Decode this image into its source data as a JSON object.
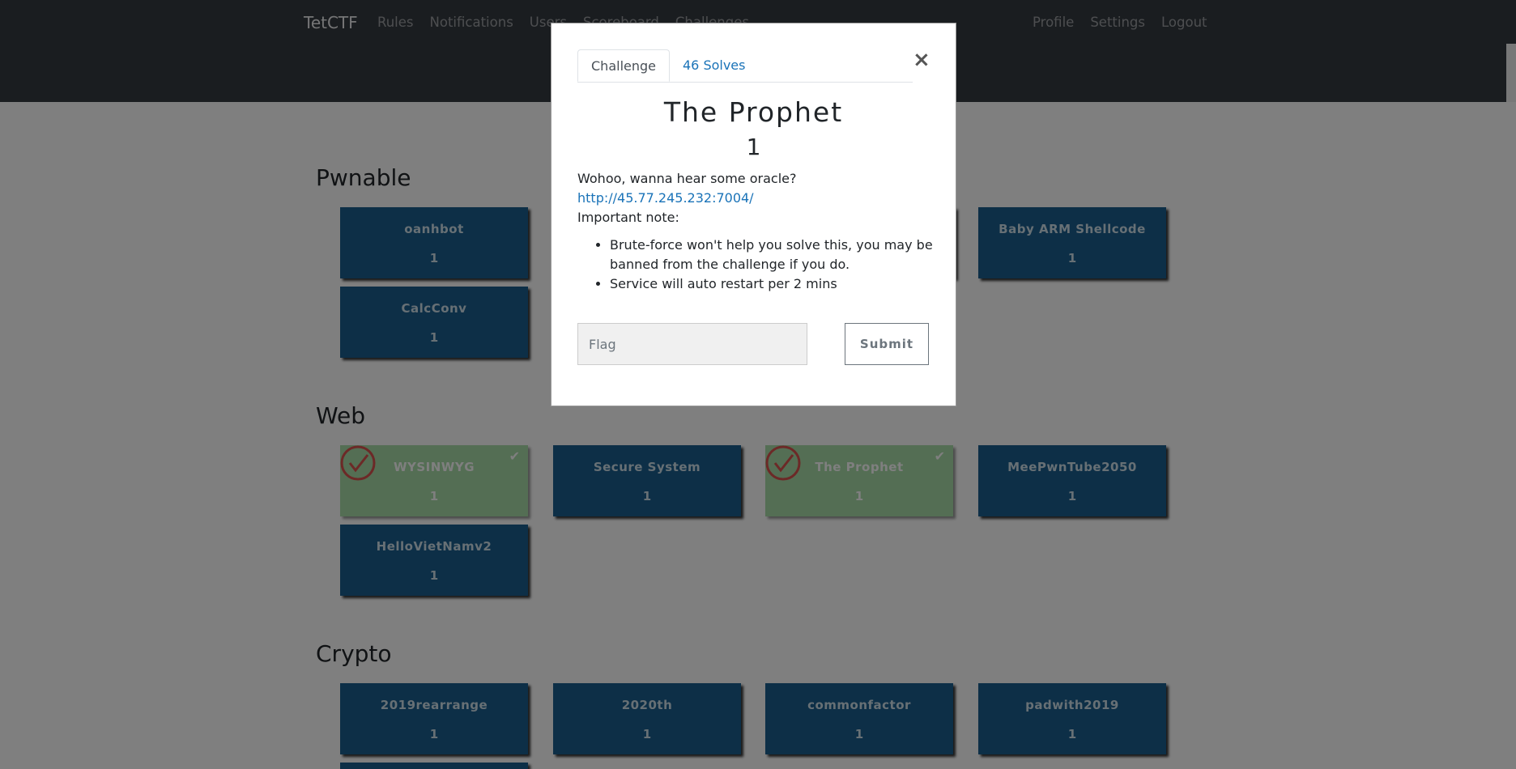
{
  "navbar": {
    "brand": "TetCTF",
    "left_links": [
      "Rules",
      "Notifications",
      "Users",
      "Scoreboard",
      "Challenges"
    ],
    "right_links": [
      "Profile",
      "Settings",
      "Logout"
    ]
  },
  "categories": [
    {
      "name": "Pwnable",
      "challenges": [
        {
          "name": "oanhbot",
          "value": "1"
        },
        {
          "name": "Baby ARM Shellcode",
          "value": "1"
        },
        {
          "name": "CalcConv",
          "value": "1"
        }
      ]
    },
    {
      "name": "Web",
      "challenges": [
        {
          "name": "WYSINWYG",
          "value": "1",
          "solved": true
        },
        {
          "name": "Secure System",
          "value": "1"
        },
        {
          "name": "The Prophet",
          "value": "1",
          "solved": true
        },
        {
          "name": "MeePwnTube2050",
          "value": "1"
        },
        {
          "name": "HelloVietNamv2",
          "value": "1"
        }
      ]
    },
    {
      "name": "Crypto",
      "challenges": [
        {
          "name": "2019rearrange",
          "value": "1"
        },
        {
          "name": "2020th",
          "value": "1"
        },
        {
          "name": "commonfactor",
          "value": "1"
        },
        {
          "name": "padwith2019",
          "value": "1"
        }
      ]
    }
  ],
  "modal": {
    "tab_challenge": "Challenge",
    "tab_solves": "46 Solves",
    "close": "×",
    "title": "The Prophet",
    "value": "1",
    "description_intro": "Wohoo, wanna hear some oracle?",
    "link": "http://45.77.245.232:7004/",
    "note_heading": "Important note:",
    "notes": [
      "Brute-force won't help you solve this, you may be banned from the challenge if you do.",
      "Service will auto restart per 2 mins"
    ],
    "flag_placeholder": "Flag",
    "submit_label": "Submit"
  },
  "colors": {
    "navbar": "#343a40",
    "card": "#1a5f8e",
    "solved_card": "#a8dca8",
    "solved_ring": "#d9534f",
    "link": "#1a73b8"
  }
}
